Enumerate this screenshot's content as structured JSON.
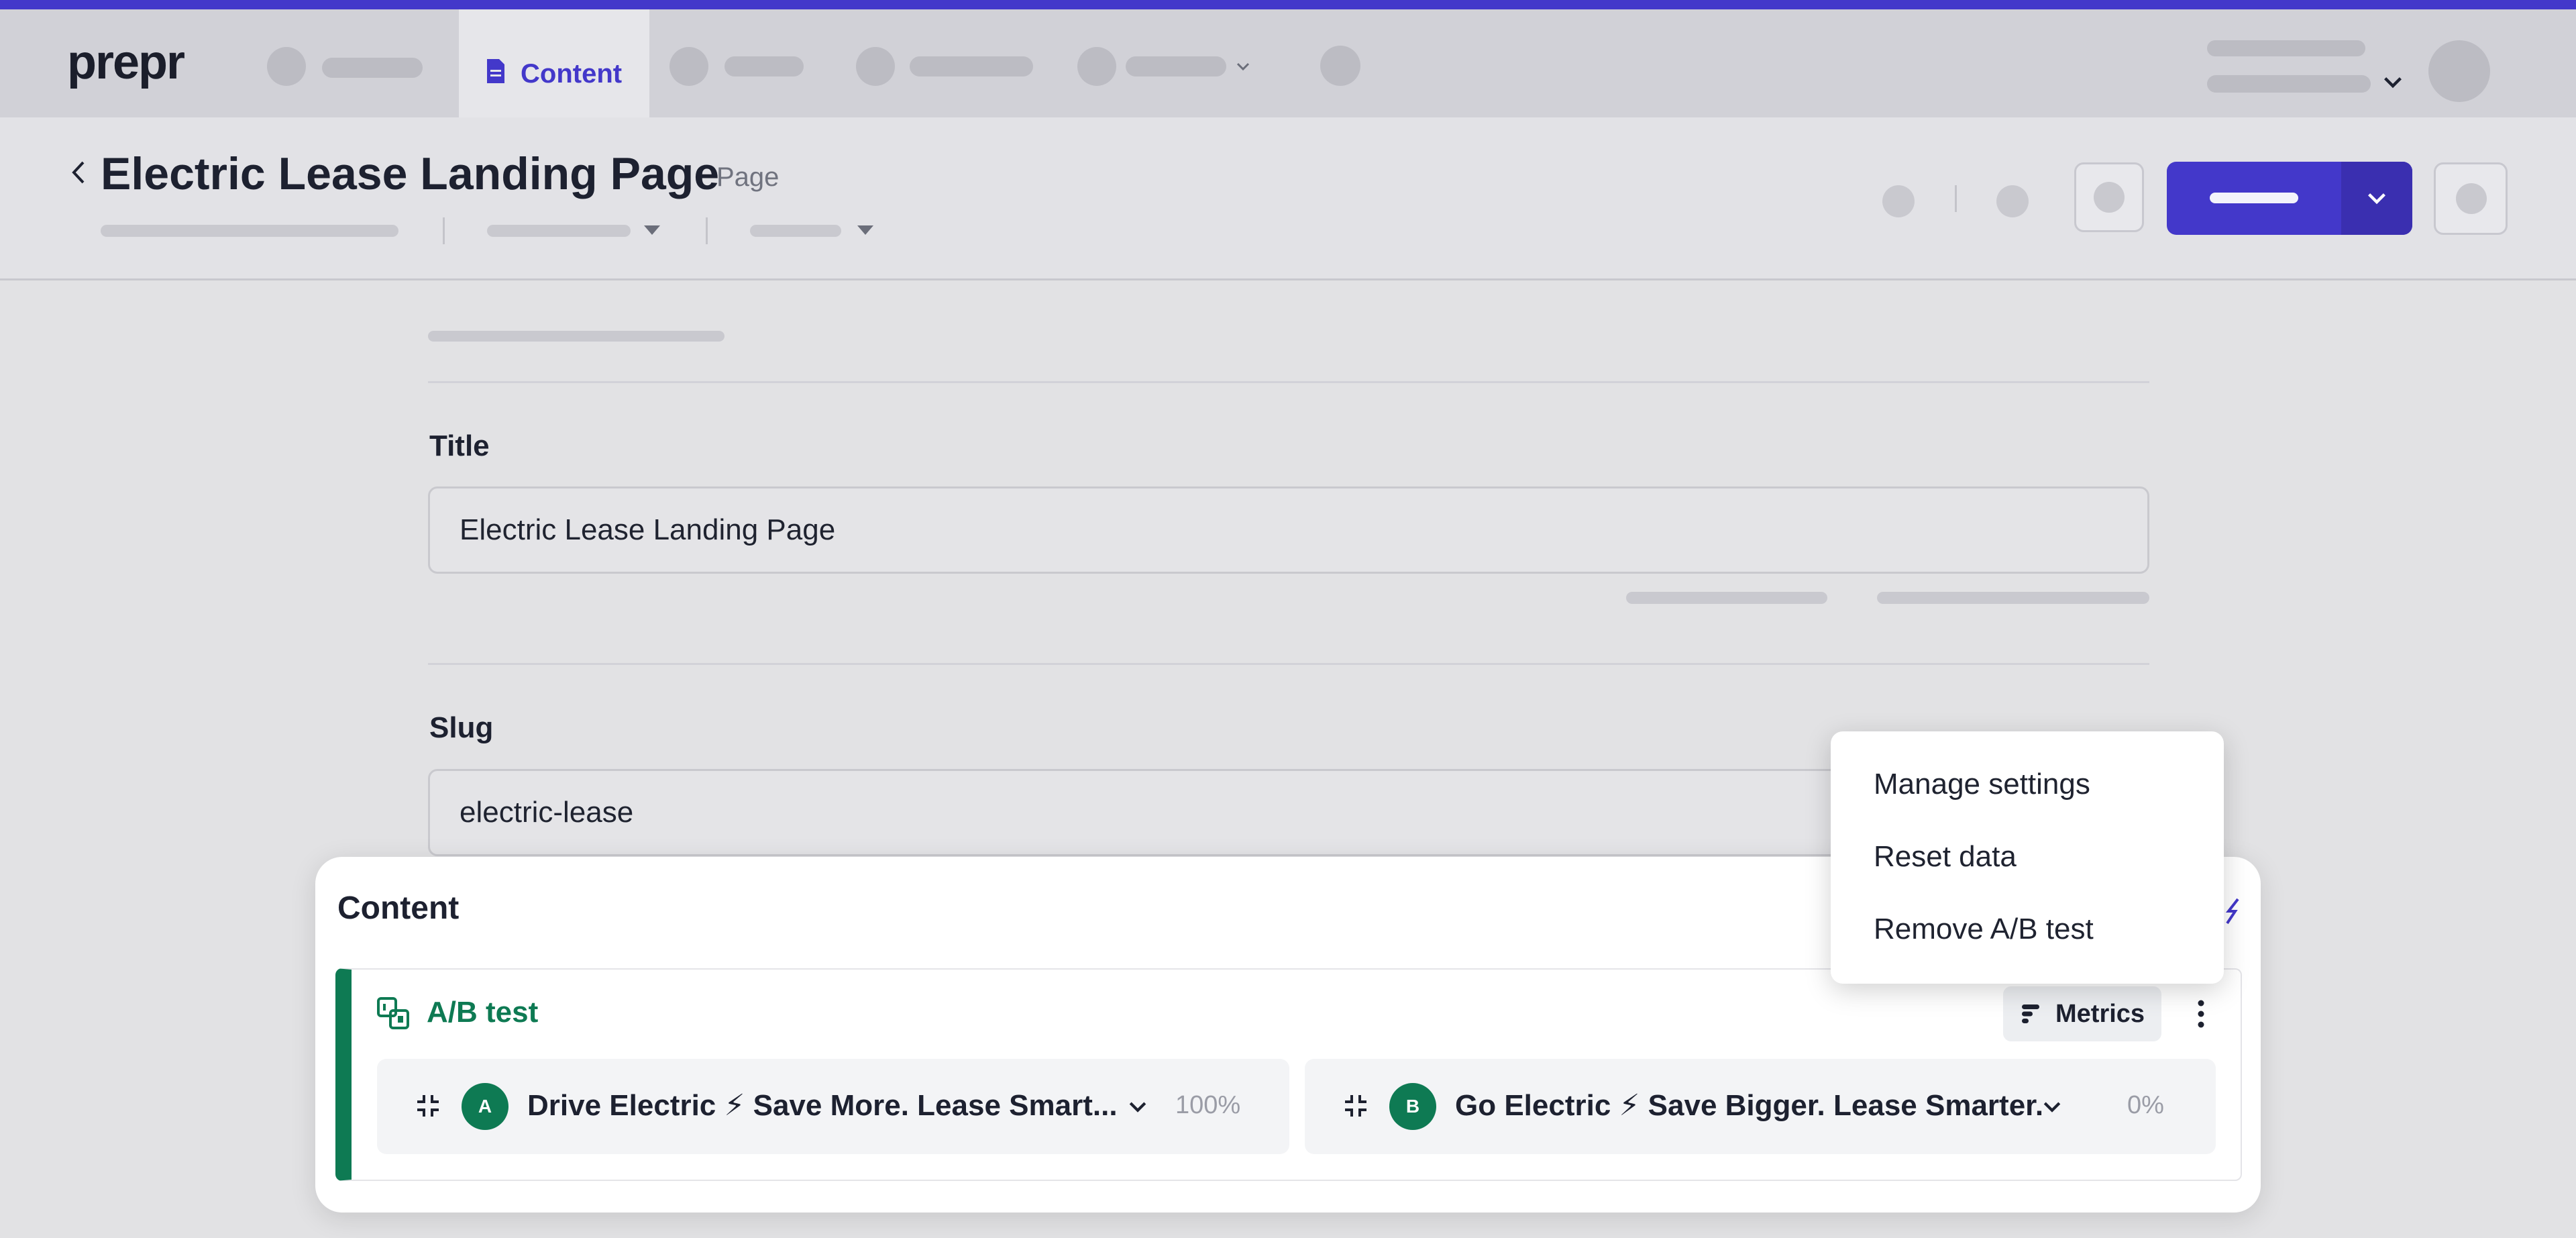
{
  "app": {
    "logo": "prepr"
  },
  "nav": {
    "active_tab": "Content"
  },
  "header": {
    "title": "Electric Lease Landing Page",
    "type": "Page"
  },
  "fields": {
    "title": {
      "label": "Title",
      "value": "Electric Lease Landing Page"
    },
    "slug": {
      "label": "Slug",
      "value": "electric-lease"
    }
  },
  "content_section": {
    "heading": "Content",
    "ab_test": {
      "label": "A/B test",
      "metrics_label": "Metrics",
      "variants": [
        {
          "badge": "A",
          "title": "Drive Electric ⚡ Save More. Lease Smart...",
          "percent": "100%"
        },
        {
          "badge": "B",
          "title": "Go Electric ⚡ Save Bigger. Lease Smarter.",
          "percent": "0%"
        }
      ]
    }
  },
  "menu": {
    "items": [
      {
        "label": "Manage settings"
      },
      {
        "label": "Reset data"
      },
      {
        "label": "Remove A/B test"
      }
    ]
  },
  "colors": {
    "brand": "#4338ca",
    "ab_green": "#0e7a53"
  },
  "icons": [
    "document-icon",
    "back-chevron-icon",
    "ab-test-icon",
    "metrics-icon",
    "kebab-menu-icon",
    "collapse-icon",
    "chevron-down-icon"
  ]
}
